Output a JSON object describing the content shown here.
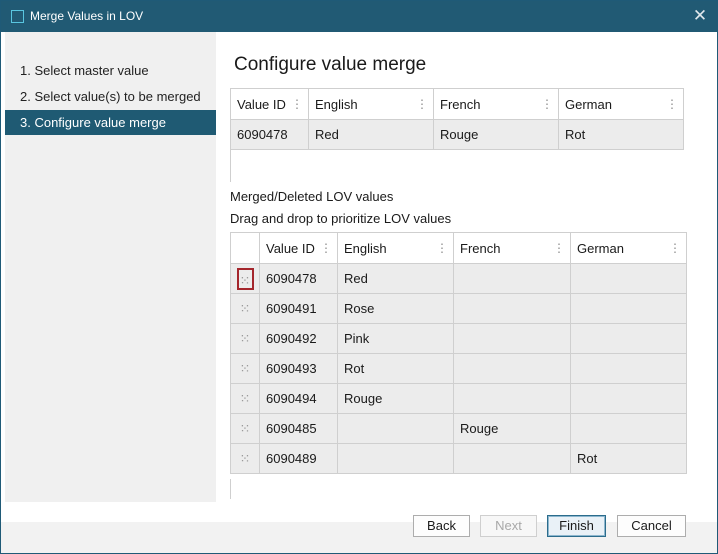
{
  "window": {
    "title": "Merge Values in LOV",
    "close_glyph": "✕"
  },
  "steps": [
    {
      "label": "1. Select master value",
      "active": false
    },
    {
      "label": "2. Select value(s) to be merged",
      "active": false
    },
    {
      "label": "3. Configure value merge",
      "active": true
    }
  ],
  "heading": "Configure value merge",
  "master_table": {
    "columns": [
      "Value ID",
      "English",
      "French",
      "German"
    ],
    "row": [
      "6090478",
      "Red",
      "Rouge",
      "Rot"
    ]
  },
  "merged_label": "Merged/Deleted LOV values",
  "drag_hint": "Drag and drop to prioritize LOV values",
  "merged_table": {
    "columns": [
      "",
      "Value ID",
      "English",
      "French",
      "German"
    ],
    "handle_glyph": "⁙",
    "rows": [
      [
        "6090478",
        "Red",
        "",
        ""
      ],
      [
        "6090491",
        "Rose",
        "",
        ""
      ],
      [
        "6090492",
        "Pink",
        "",
        ""
      ],
      [
        "6090493",
        "Rot",
        "",
        ""
      ],
      [
        "6090494",
        "Rouge",
        "",
        ""
      ],
      [
        "6090485",
        "",
        "Rouge",
        ""
      ],
      [
        "6090489",
        "",
        "",
        "Rot"
      ]
    ]
  },
  "buttons": {
    "back": "Back",
    "next": "Next",
    "finish": "Finish",
    "cancel": "Cancel"
  },
  "colors": {
    "titlebar": "#215a74",
    "active_step": "#1f5a73",
    "selected_handle": "#a4262c"
  }
}
